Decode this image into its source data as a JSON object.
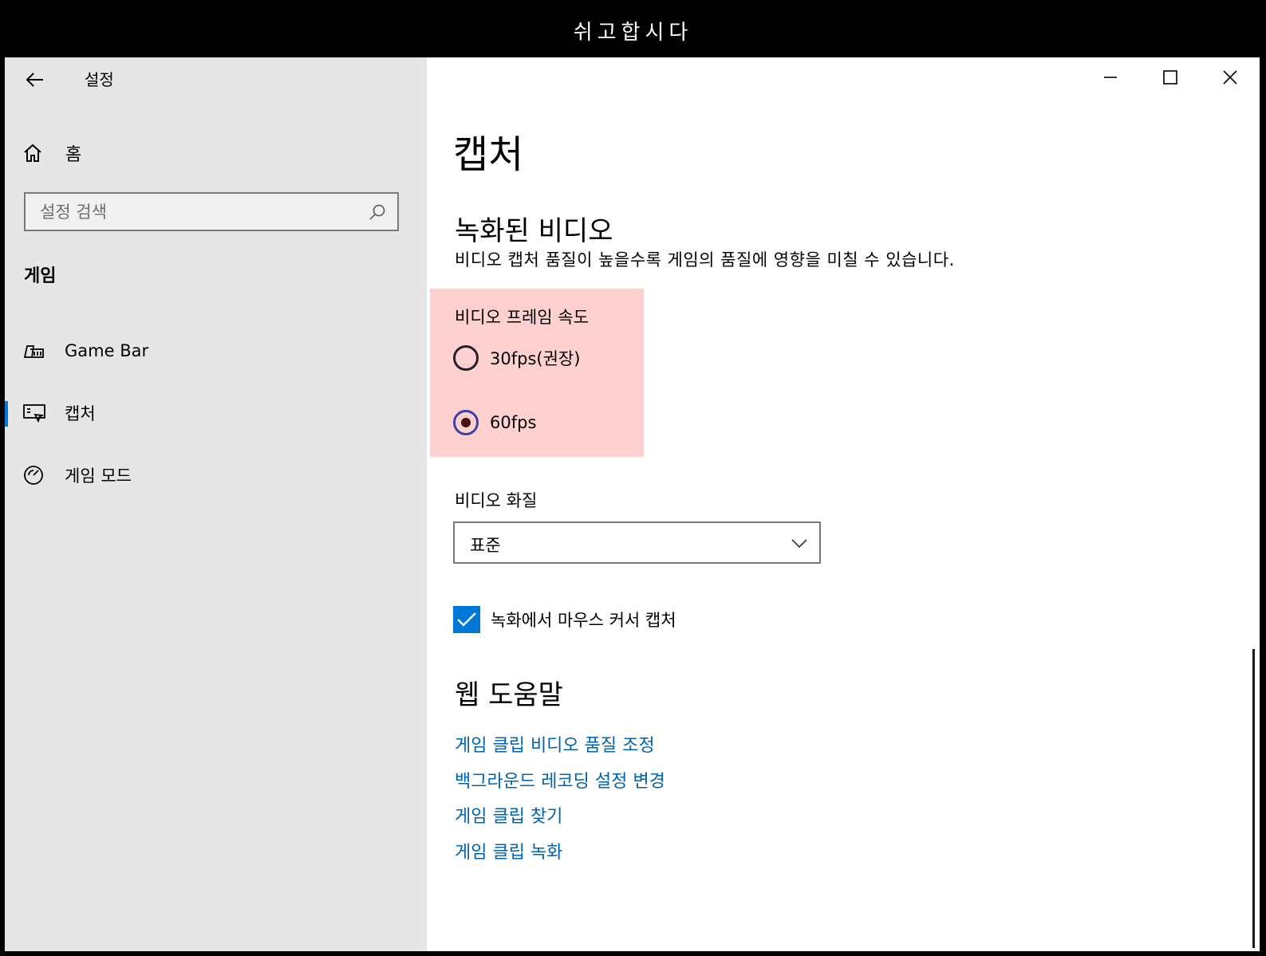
{
  "overlay": {
    "title": "쉬고합시다"
  },
  "window": {
    "app_title": "설정",
    "controls": {
      "minimize_icon": "minimize-icon",
      "maximize_icon": "maximize-icon",
      "close_icon": "close-icon"
    }
  },
  "sidebar": {
    "home_label": "홈",
    "search_placeholder": "설정 검색",
    "section_label": "게임",
    "items": [
      {
        "label": "Game Bar",
        "icon": "game-bar-icon",
        "active": false
      },
      {
        "label": "캡처",
        "icon": "capture-icon",
        "active": true
      },
      {
        "label": "게임 모드",
        "icon": "game-mode-icon",
        "active": false
      }
    ]
  },
  "main": {
    "page_title": "캡처",
    "recorded_video": {
      "heading": "녹화된 비디오",
      "description": "비디오 캡처 품질이 높을수록 게임의 품질에 영향을 미칠 수 있습니다."
    },
    "frame_rate": {
      "label": "비디오 프레임 속도",
      "options": [
        {
          "label": "30fps(권장)",
          "selected": false
        },
        {
          "label": "60fps",
          "selected": true
        }
      ]
    },
    "video_quality": {
      "label": "비디오 화질",
      "selected": "표준"
    },
    "mouse_cursor": {
      "label": "녹화에서 마우스 커서 캡처",
      "checked": true
    },
    "web_help": {
      "heading": "웹 도움말",
      "links": [
        "게임 클립 비디오 품질 조정",
        "백그라운드 레코딩 설정 변경",
        "게임 클립 찾기",
        "게임 클립 녹화"
      ]
    }
  },
  "colors": {
    "accent": "#0078d7",
    "link": "#0063b1",
    "highlight": "#ffd0d0",
    "sidebar_bg": "#e6e6e6"
  }
}
